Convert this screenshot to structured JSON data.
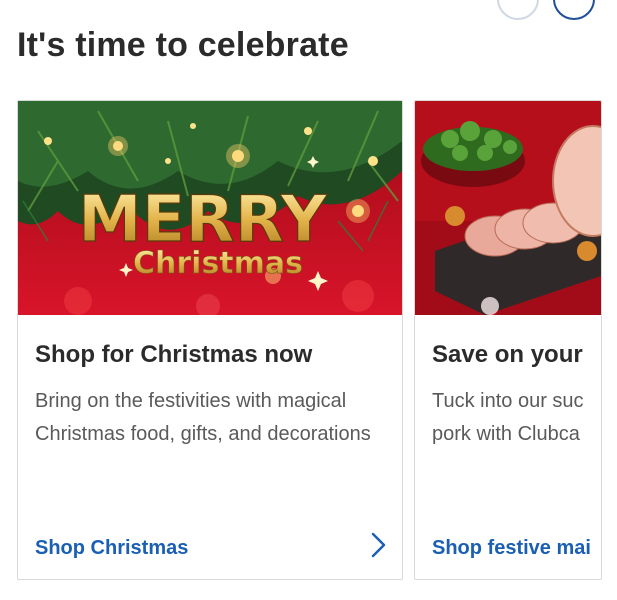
{
  "section": {
    "title": "It's time to celebrate"
  },
  "colors": {
    "link": "#1a5fb4",
    "title": "#2b2b2b",
    "body": "#5a5a5a",
    "festive_red": "#c8102e"
  },
  "cards": [
    {
      "image_text_1": "MERRY",
      "image_text_2": "Christmas",
      "title": "Shop for Christmas now",
      "description": "Bring on the festivities with magical Christmas food, gifts, and decorations",
      "link": "Shop Christmas",
      "icon": "chevron-right-icon"
    },
    {
      "title": "Save on your",
      "description_line_1": "Tuck into our suc",
      "description_line_2": "pork with Clubca",
      "link": "Shop festive mai"
    }
  ]
}
